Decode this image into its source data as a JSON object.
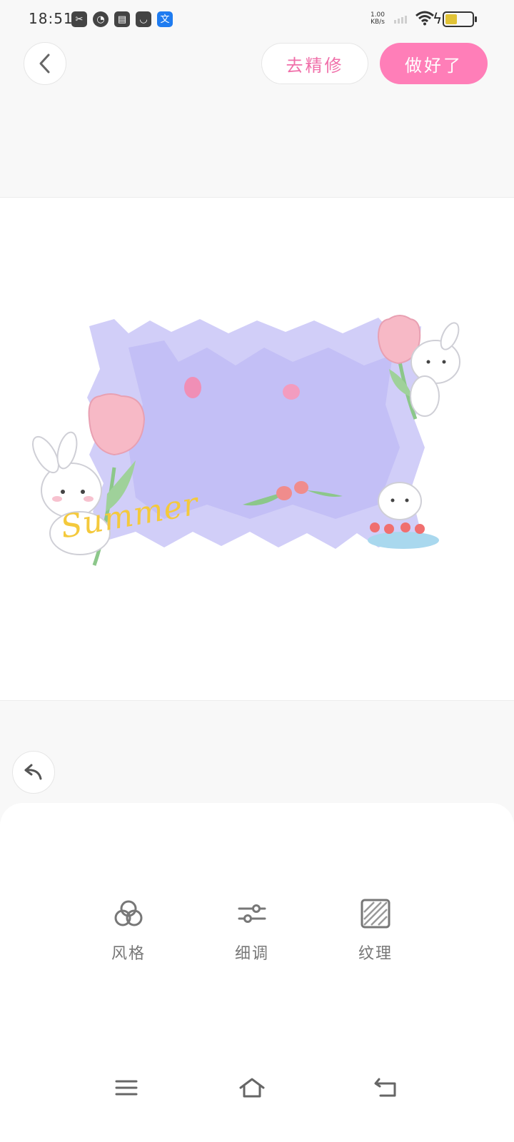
{
  "status_bar": {
    "time": "18:51",
    "net_speed_value": "1.00",
    "net_speed_unit": "KB/s",
    "battery_level": 0.45,
    "app_icons": [
      "scissors-app-icon",
      "gauge-app-icon",
      "wallet-app-icon",
      "bag-app-icon",
      "translate-app-icon"
    ]
  },
  "header": {
    "refine_label": "去精修",
    "done_label": "做好了"
  },
  "canvas": {
    "sticker_text": "Summer"
  },
  "tools": [
    {
      "label": "风格",
      "icon": "three-circles-icon"
    },
    {
      "label": "细调",
      "icon": "sliders-icon"
    },
    {
      "label": "纹理",
      "icon": "texture-icon"
    }
  ],
  "colors": {
    "accent_pink": "#ff7eb8",
    "refine_text_pink": "#f06fa9",
    "lavender": "#c9c6f7",
    "summer_yellow": "#f4c93c"
  },
  "nav": [
    "menu-icon",
    "home-icon",
    "back-nav-icon"
  ]
}
